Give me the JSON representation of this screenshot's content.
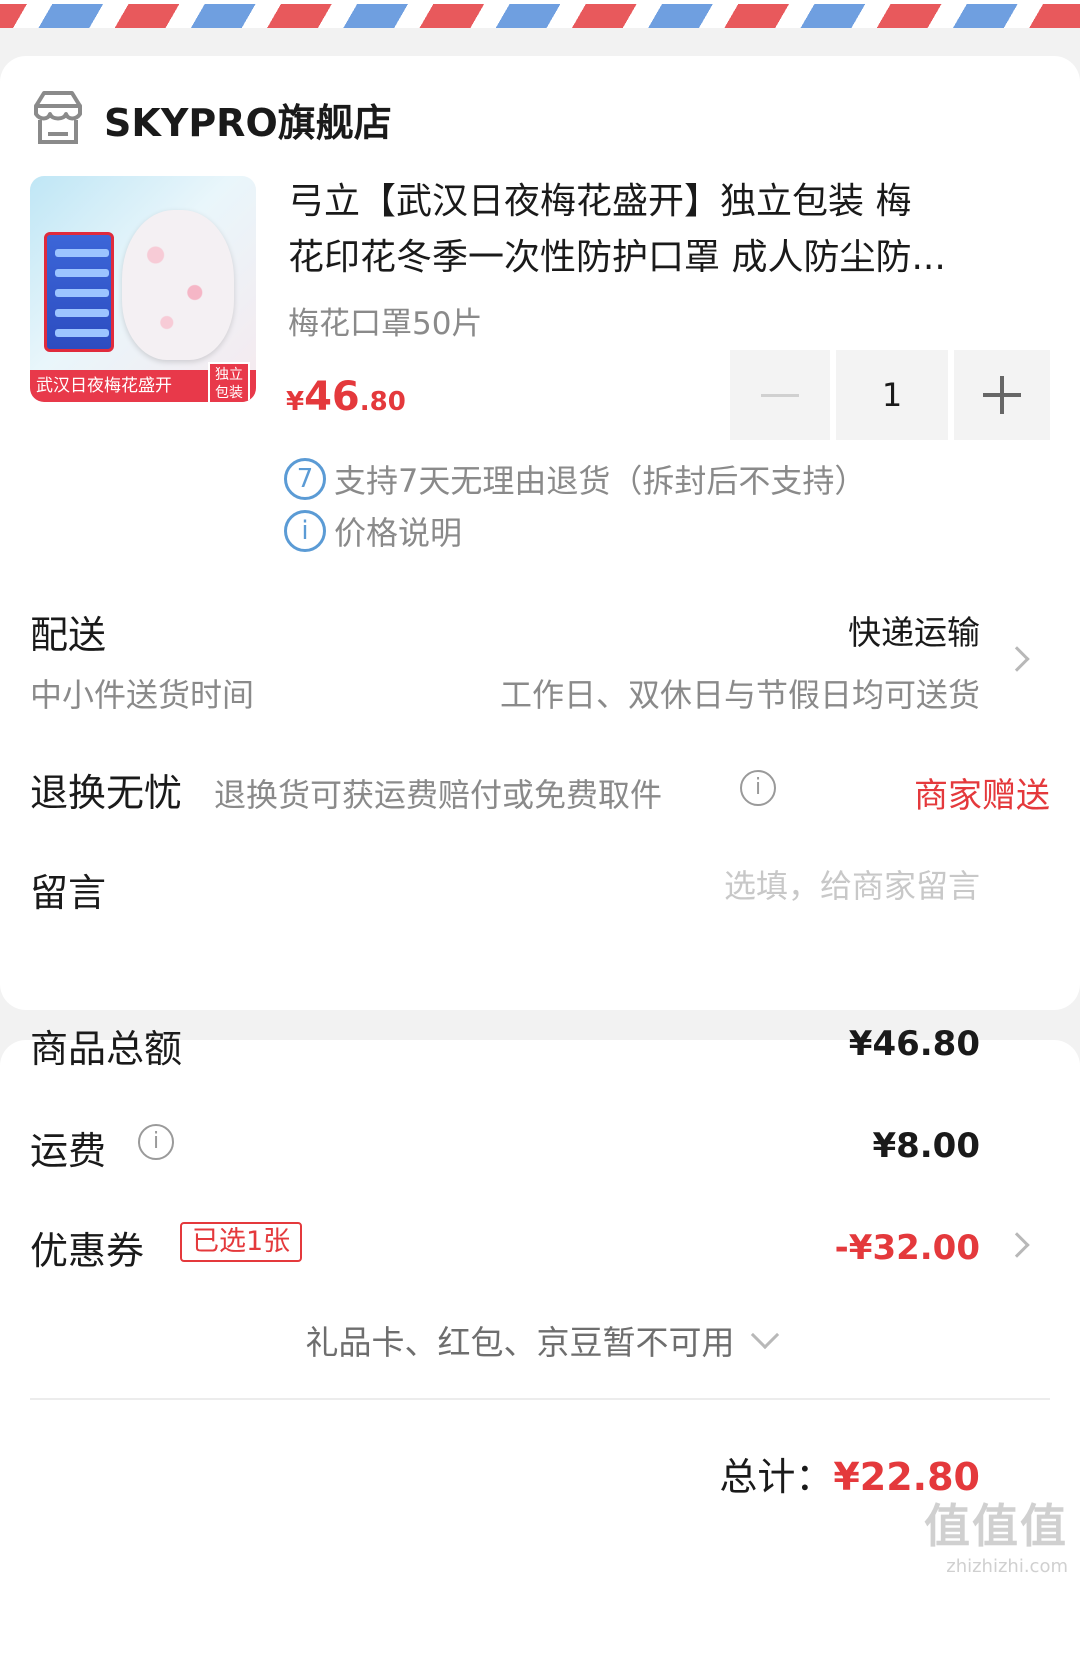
{
  "store": {
    "name": "SKYPRO旗舰店",
    "icon": "store-icon"
  },
  "product": {
    "title_line1": "弓立【武汉日夜梅花盛开】独立包装 梅",
    "title_line2": "花印花冬季一次性防护口罩 成人防尘防...",
    "spec": "梅花口罩50片",
    "price_symbol": "¥",
    "price_int": "46",
    "price_dec": ".80",
    "quantity": "1",
    "image_banner": "武汉日夜梅花盛开",
    "image_tag": "独立包装",
    "return_policy": "支持7天无理由退货（拆封后不支持）",
    "return_policy_icon_text": "7",
    "price_note": "价格说明",
    "price_note_icon_text": "i"
  },
  "delivery": {
    "label": "配送",
    "method": "快递运输",
    "time_label": "中小件送货时间",
    "time_value": "工作日、双休日与节假日均可送货"
  },
  "returns": {
    "label": "退换无忧",
    "desc": "退换货可获运费赔付或免费取件",
    "gift": "商家赠送"
  },
  "message": {
    "label": "留言",
    "placeholder": "选填，给商家留言"
  },
  "summary": {
    "goods_label": "商品总额",
    "goods_value": "¥46.80",
    "shipping_label": "运费",
    "shipping_value": "¥8.00",
    "coupon_label": "优惠券",
    "coupon_badge": "已选1张",
    "coupon_value": "-¥32.00",
    "unavailable": "礼品卡、红包、京豆暂不可用",
    "total_label": "总计：",
    "total_value": "¥22.80"
  },
  "watermark": {
    "logo": "值值值",
    "site": "zhizhizhi.com"
  },
  "colors": {
    "accent_red": "#e4393c",
    "info_blue": "#5b9bd5",
    "airmail_red": "#e8595c",
    "airmail_blue": "#6f9fe0"
  }
}
